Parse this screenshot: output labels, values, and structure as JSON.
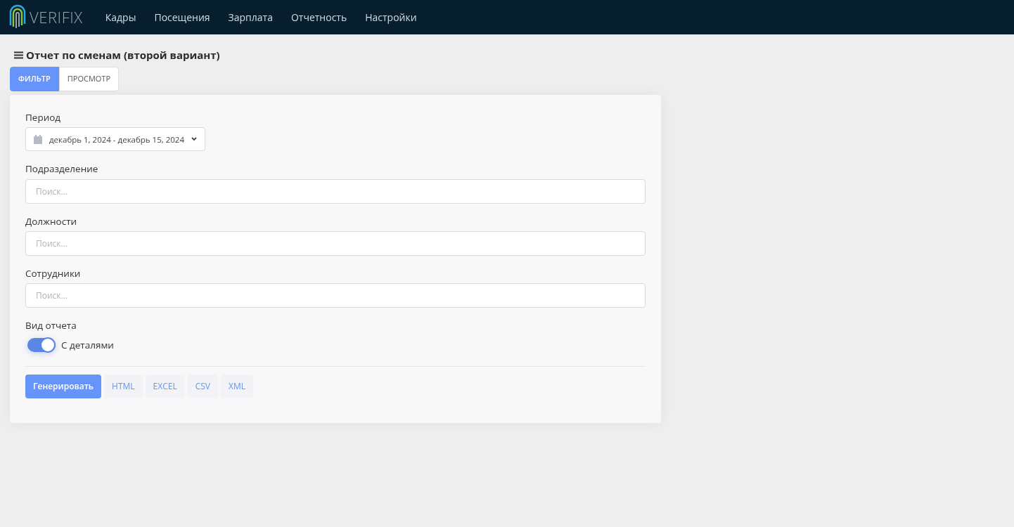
{
  "navbar": {
    "brand": "VERIFIX",
    "items": [
      "Кадры",
      "Посещения",
      "Зарплата",
      "Отчетность",
      "Настройки"
    ]
  },
  "page_title": "Отчет по сменам (второй вариант)",
  "tabs": [
    {
      "label": "ФИЛЬТР",
      "selected": true
    },
    {
      "label": "ПРОСМОТР",
      "selected": false
    }
  ],
  "form": {
    "period": {
      "label": "Период",
      "value": "декабрь 1, 2024 - декабрь 15, 2024"
    },
    "fields": [
      {
        "label": "Подразделение",
        "placeholder": "Поиск..."
      },
      {
        "label": "Должности",
        "placeholder": "Поиск..."
      },
      {
        "label": "Сотрудники",
        "placeholder": "Поиск..."
      }
    ],
    "report_type": {
      "label": "Вид отчета",
      "toggle_label": "С деталями",
      "on": true
    },
    "buttons": [
      {
        "label": "Генерировать",
        "kind": "primary"
      },
      {
        "label": "HTML",
        "kind": "light"
      },
      {
        "label": "EXCEL",
        "kind": "light"
      },
      {
        "label": "CSV",
        "kind": "light"
      },
      {
        "label": "XML",
        "kind": "light"
      }
    ]
  }
}
